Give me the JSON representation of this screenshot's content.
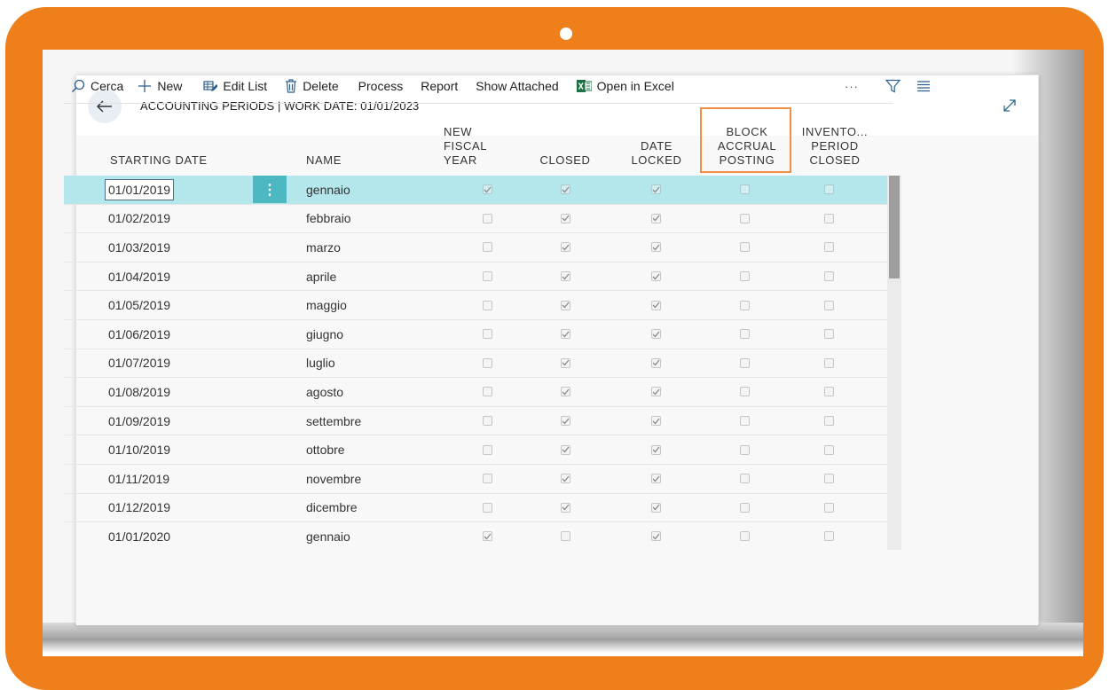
{
  "window": {
    "title": "ACCOUNTING PERIODS | WORK DATE: 01/01/2023"
  },
  "actions": {
    "search": "Cerca",
    "new": "New",
    "edit_list": "Edit List",
    "delete": "Delete",
    "process": "Process",
    "report": "Report",
    "show_attached": "Show Attached",
    "open_in_excel": "Open in Excel",
    "more": "···"
  },
  "columns": {
    "starting_date": "STARTING DATE",
    "name": "NAME",
    "new_fiscal_year": [
      "NEW",
      "FISCAL",
      "YEAR"
    ],
    "closed": "CLOSED",
    "date_locked": [
      "DATE",
      "LOCKED"
    ],
    "block_accrual_posting": [
      "BLOCK",
      "ACCRUAL",
      "POSTING"
    ],
    "inventory_period_closed": [
      "INVENTO...",
      "PERIOD",
      "CLOSED"
    ]
  },
  "rows": [
    {
      "date": "01/01/2019",
      "name": "gennaio",
      "new_fiscal_year": true,
      "closed": true,
      "date_locked": true,
      "block_accrual": false,
      "inventory_closed": false
    },
    {
      "date": "01/02/2019",
      "name": "febbraio",
      "new_fiscal_year": false,
      "closed": true,
      "date_locked": true,
      "block_accrual": false,
      "inventory_closed": false
    },
    {
      "date": "01/03/2019",
      "name": "marzo",
      "new_fiscal_year": false,
      "closed": true,
      "date_locked": true,
      "block_accrual": false,
      "inventory_closed": false
    },
    {
      "date": "01/04/2019",
      "name": "aprile",
      "new_fiscal_year": false,
      "closed": true,
      "date_locked": true,
      "block_accrual": false,
      "inventory_closed": false
    },
    {
      "date": "01/05/2019",
      "name": "maggio",
      "new_fiscal_year": false,
      "closed": true,
      "date_locked": true,
      "block_accrual": false,
      "inventory_closed": false
    },
    {
      "date": "01/06/2019",
      "name": "giugno",
      "new_fiscal_year": false,
      "closed": true,
      "date_locked": true,
      "block_accrual": false,
      "inventory_closed": false
    },
    {
      "date": "01/07/2019",
      "name": "luglio",
      "new_fiscal_year": false,
      "closed": true,
      "date_locked": true,
      "block_accrual": false,
      "inventory_closed": false
    },
    {
      "date": "01/08/2019",
      "name": "agosto",
      "new_fiscal_year": false,
      "closed": true,
      "date_locked": true,
      "block_accrual": false,
      "inventory_closed": false
    },
    {
      "date": "01/09/2019",
      "name": "settembre",
      "new_fiscal_year": false,
      "closed": true,
      "date_locked": true,
      "block_accrual": false,
      "inventory_closed": false
    },
    {
      "date": "01/10/2019",
      "name": "ottobre",
      "new_fiscal_year": false,
      "closed": true,
      "date_locked": true,
      "block_accrual": false,
      "inventory_closed": false
    },
    {
      "date": "01/11/2019",
      "name": "novembre",
      "new_fiscal_year": false,
      "closed": true,
      "date_locked": true,
      "block_accrual": false,
      "inventory_closed": false
    },
    {
      "date": "01/12/2019",
      "name": "dicembre",
      "new_fiscal_year": false,
      "closed": true,
      "date_locked": true,
      "block_accrual": false,
      "inventory_closed": false
    },
    {
      "date": "01/01/2020",
      "name": "gennaio",
      "new_fiscal_year": true,
      "closed": false,
      "date_locked": true,
      "block_accrual": false,
      "inventory_closed": false
    }
  ],
  "selected_row": 0,
  "scroll_position": 0,
  "colors": {
    "frame": "#ef7f1a",
    "selected_row": "#b3e7ec",
    "row_menu": "#4db7c2",
    "highlight_box": "#ef8f48",
    "excel_green": "#1e7145"
  },
  "icons": {
    "back": "back-arrow-icon",
    "expand": "expand-icon",
    "search": "search-icon",
    "new": "plus-icon",
    "edit_list": "edit-list-icon",
    "delete": "trash-icon",
    "excel": "excel-icon",
    "filter": "filter-icon",
    "list_view": "list-view-icon"
  }
}
